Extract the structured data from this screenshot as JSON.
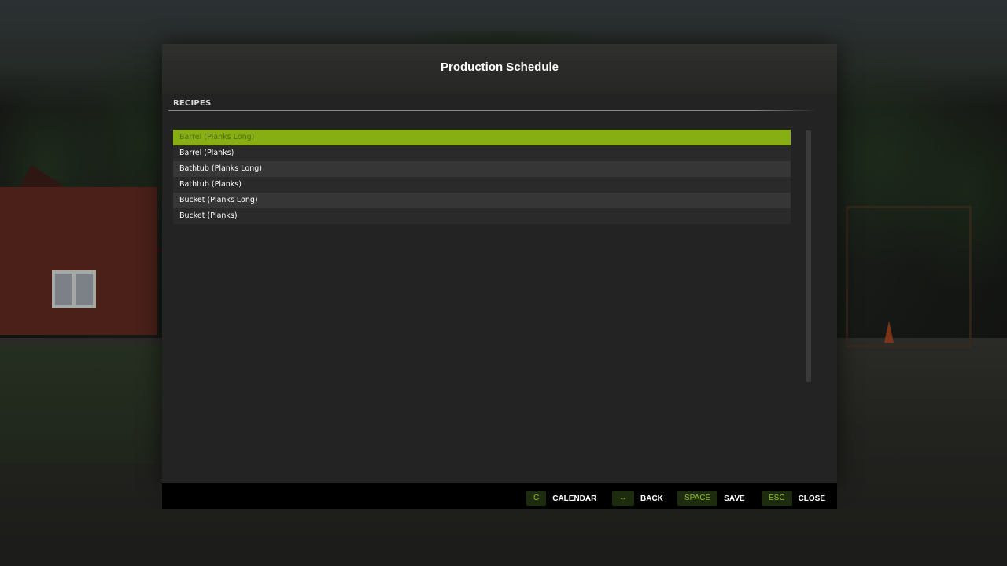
{
  "dialog": {
    "title": "Production Schedule",
    "section_label": "RECIPES"
  },
  "recipes": [
    {
      "label": "Barrel (Planks Long)",
      "selected": true
    },
    {
      "label": "Barrel (Planks)",
      "selected": false
    },
    {
      "label": "Bathtub (Planks Long)",
      "selected": false
    },
    {
      "label": "Bathtub (Planks)",
      "selected": false
    },
    {
      "label": "Bucket (Planks Long)",
      "selected": false
    },
    {
      "label": "Bucket (Planks)",
      "selected": false
    }
  ],
  "footer": {
    "hints": [
      {
        "key": "C",
        "label": "CALENDAR"
      },
      {
        "key": "↔",
        "label": "BACK"
      },
      {
        "key": "SPACE",
        "label": "SAVE"
      },
      {
        "key": "ESC",
        "label": "CLOSE"
      }
    ]
  },
  "colors": {
    "accent": "#87af14",
    "key_text": "#8fbf1c",
    "panel": "#232323"
  },
  "icons": {
    "back_key": "left-right-arrow-icon"
  }
}
